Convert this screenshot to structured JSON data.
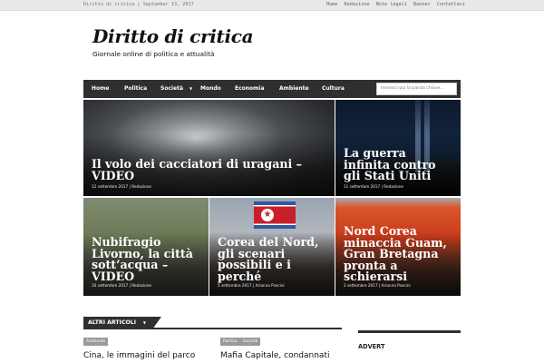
{
  "topbar": {
    "site_date": "Diritto di critica | September 13, 2017",
    "links": [
      "Home",
      "Redazione",
      "Note legali",
      "Banner",
      "Contattaci"
    ]
  },
  "header": {
    "logo_name": "Diritto di critica",
    "tagline": "Giornale online di politica e attualità"
  },
  "nav": {
    "items": [
      "Home",
      "Politica",
      "Società",
      "Mondo",
      "Economia",
      "Ambiente",
      "Cultura"
    ],
    "search_placeholder": "Inserisci qui la parola chiave..."
  },
  "featured": [
    {
      "title": "Il volo dei cacciatori di uragani – VIDEO",
      "meta": "12 settembre 2017 | Redazione"
    },
    {
      "title": "La guerra infinita contro gli Stati Uniti",
      "meta": "11 settembre 2017 | Redazione"
    },
    {
      "title": "Nubifragio Livorno, la città sott’acqua – VIDEO",
      "meta": "10 settembre 2017 | Redazione"
    },
    {
      "title": "Corea del Nord, gli scenari possibili e i perché",
      "meta": "5 settembre 2017 | Arianna Psecini"
    },
    {
      "title": "Nord Corea minaccia Guam, Gran Bretagna pronta a schierarsi",
      "meta": "2 settembre 2017 | Arianna Psecini"
    }
  ],
  "more": {
    "header": "ALTRI ARTICOLI",
    "articles": [
      {
        "tags": [
          "Ambiente"
        ],
        "title": "Cina, le immagini del parco"
      },
      {
        "tags": [
          "Politica",
          "Società"
        ],
        "title": "Mafia Capitale, condannati"
      }
    ]
  },
  "sidebar": {
    "advert_label": "ADVERT"
  }
}
